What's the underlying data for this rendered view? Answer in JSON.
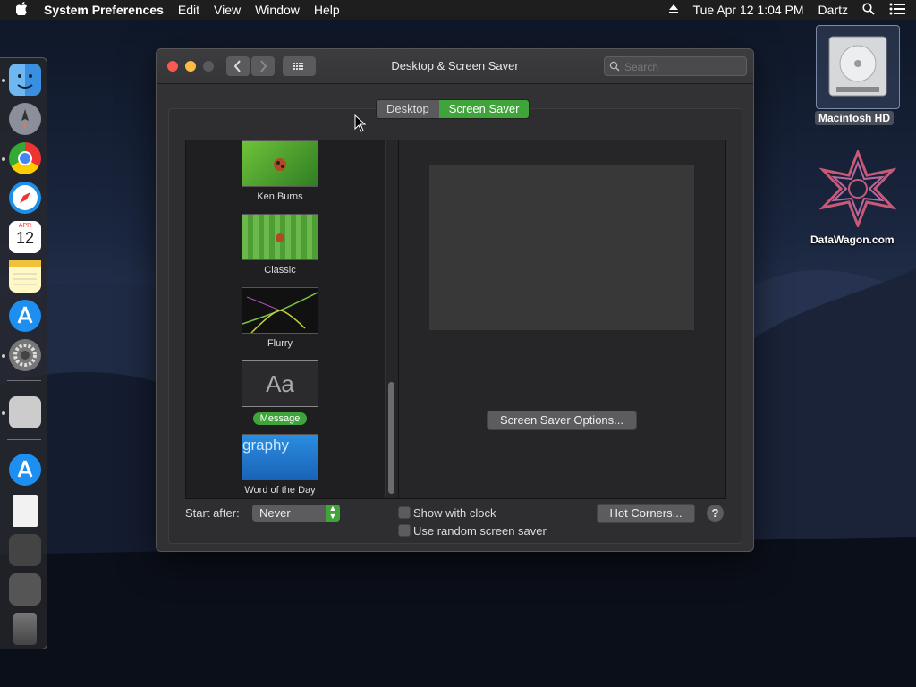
{
  "menubar": {
    "apple_icon": "apple-icon",
    "app_name": "System Preferences",
    "menus": [
      "Edit",
      "View",
      "Window",
      "Help"
    ],
    "datetime": "Tue Apr 12  1:04 PM",
    "user": "Dartz"
  },
  "desktop": {
    "hd_label": "Macintosh HD",
    "datawagon_label": "DataWagon.com"
  },
  "window": {
    "title": "Desktop & Screen Saver",
    "search_placeholder": "Search",
    "tabs": [
      "Desktop",
      "Screen Saver"
    ],
    "active_tab": "Screen Saver",
    "screen_savers": [
      {
        "label": "Ken Burns",
        "selected": false
      },
      {
        "label": "Classic",
        "selected": false
      },
      {
        "label": "Flurry",
        "selected": false
      },
      {
        "label": "Message",
        "selected": true,
        "thumb_text": "Aa"
      },
      {
        "label": "Word of the Day",
        "selected": false,
        "thumb_text": "graphy"
      }
    ],
    "options_button": "Screen Saver Options...",
    "start_after_label": "Start after:",
    "start_after_value": "Never",
    "show_clock_label": "Show with clock",
    "random_label": "Use random screen saver",
    "hot_corners_button": "Hot Corners...",
    "help_label": "?"
  },
  "calendar": {
    "month": "APR",
    "day": "12"
  }
}
